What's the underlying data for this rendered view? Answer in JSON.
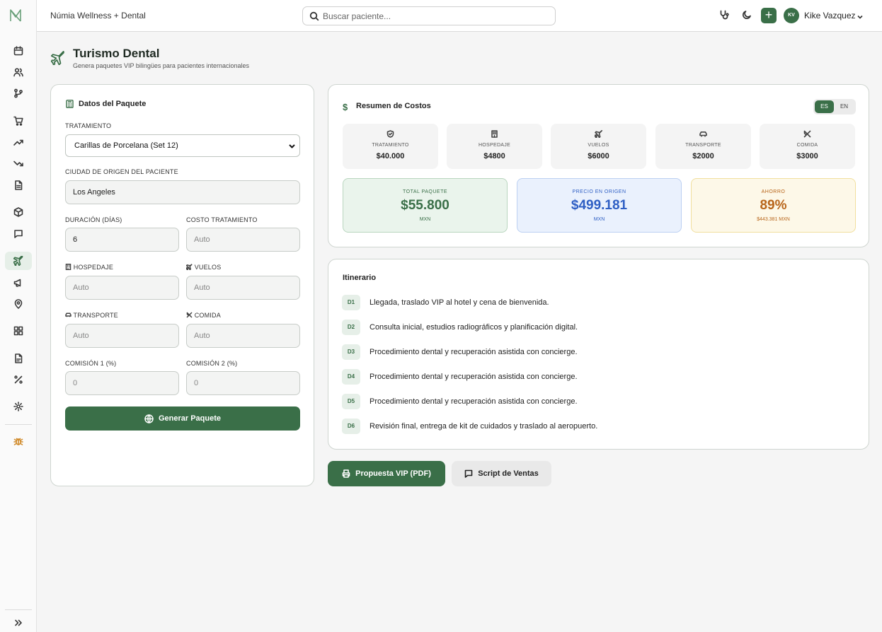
{
  "header": {
    "app_name": "Númia Wellness + Dental",
    "search_placeholder": "Buscar paciente...",
    "user_initials": "KV",
    "user_name": "Kike Vazquez",
    "plus_label": "+"
  },
  "page": {
    "title": "Turismo Dental",
    "subtitle": "Genera paquetes VIP bilingües para pacientes internacionales"
  },
  "form": {
    "title": "Datos del Paquete",
    "treatment_label": "TRATAMIENTO",
    "treatment_value": "Carillas de Porcelana (Set 12)",
    "city_label": "CIUDAD DE ORIGEN DEL PACIENTE",
    "city_value": "Los Angeles",
    "duration_label": "DURACIÓN (DÍAS)",
    "duration_value": "6",
    "treatment_cost_label": "COSTO TRATAMIENTO",
    "treatment_cost_placeholder": "Auto",
    "lodging_label": "HOSPEDAJE",
    "lodging_placeholder": "Auto",
    "flights_label": "VUELOS",
    "flights_placeholder": "Auto",
    "transport_label": "TRANSPORTE",
    "transport_placeholder": "Auto",
    "food_label": "COMIDA",
    "food_placeholder": "Auto",
    "commission1_label": "COMISIÓN 1 (%)",
    "commission1_placeholder": "0",
    "commission2_label": "COMISIÓN 2 (%)",
    "commission2_placeholder": "0",
    "generate_button": "Generar Paquete"
  },
  "summary": {
    "title": "Resumen de Costos",
    "lang_es": "ES",
    "lang_en": "EN",
    "costs": [
      {
        "label": "TRATAMIENTO",
        "value": "$40.000"
      },
      {
        "label": "HOSPEDAJE",
        "value": "$4800"
      },
      {
        "label": "VUELOS",
        "value": "$6000"
      },
      {
        "label": "TRANSPORTE",
        "value": "$2000"
      },
      {
        "label": "COMIDA",
        "value": "$3000"
      }
    ],
    "total": {
      "label": "TOTAL PAQUETE",
      "value": "$55.800",
      "unit": "MXN"
    },
    "origin": {
      "label": "PRECIO EN ORIGEN",
      "value": "$499.181",
      "unit": "MXN"
    },
    "savings": {
      "label": "AHORRO",
      "value": "89%",
      "unit": "$443.381 MXN"
    },
    "colors": {
      "total_bg": "#eaf4ec",
      "total_border": "#b9d6bf",
      "total_text": "#3a6f48",
      "origin_bg": "#eaf1fd",
      "origin_border": "#bcd0f2",
      "origin_text": "#2f5fc4",
      "savings_bg": "#fdf8e8",
      "savings_border": "#f1df9e",
      "savings_text": "#b8651a"
    }
  },
  "itinerary": {
    "title": "Itinerario",
    "days": [
      {
        "day": "D1",
        "text": "Llegada, traslado VIP al hotel y cena de bienvenida."
      },
      {
        "day": "D2",
        "text": "Consulta inicial, estudios radiográficos y planificación digital."
      },
      {
        "day": "D3",
        "text": "Procedimiento dental y recuperación asistida con concierge."
      },
      {
        "day": "D4",
        "text": "Procedimiento dental y recuperación asistida con concierge."
      },
      {
        "day": "D5",
        "text": "Procedimiento dental y recuperación asistida con concierge."
      },
      {
        "day": "D6",
        "text": "Revisión final, entrega de kit de cuidados y traslado al aeropuerto."
      }
    ]
  },
  "actions": {
    "pdf_button": "Propuesta VIP (PDF)",
    "script_button": "Script de Ventas"
  },
  "theme": {
    "accent": "#3a6f48"
  }
}
